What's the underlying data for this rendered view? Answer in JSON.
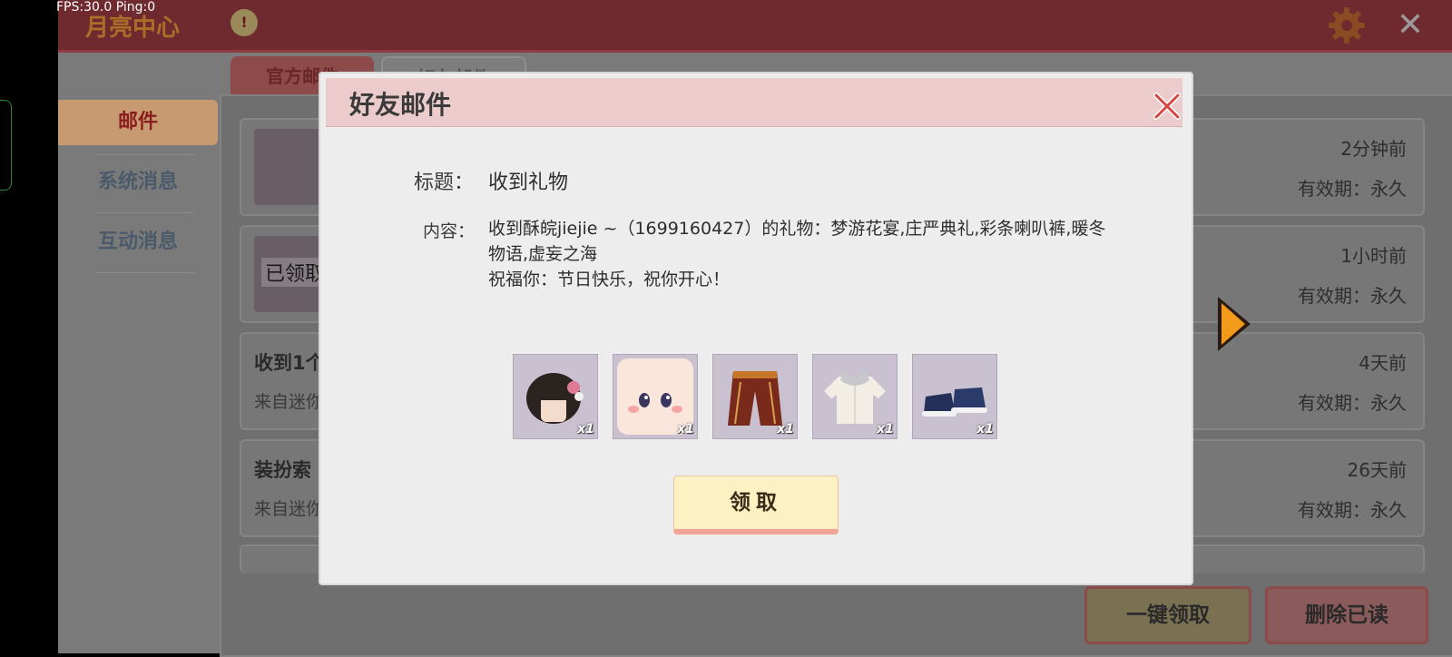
{
  "debug": {
    "fps_text": "FPS:30.0  Ping:0"
  },
  "topbar": {
    "logo_text": "月亮中心",
    "badge_text": "!"
  },
  "sidebar": {
    "items": [
      {
        "label": "邮件"
      },
      {
        "label": "系统消息"
      },
      {
        "label": "互动消息"
      }
    ]
  },
  "tabs": {
    "official": "官方邮件",
    "friend": "好友邮件"
  },
  "mail_list": [
    {
      "title": "",
      "from": "",
      "time": "2分钟前",
      "expiry": "有效期：永久",
      "has_thumb": true
    },
    {
      "title": "",
      "from": "",
      "time": "1小时前",
      "expiry": "有效期：永久",
      "has_thumb": true,
      "claimed_label": "已领取"
    },
    {
      "title": "收到1个",
      "from": "来自迷你",
      "time": "4天前",
      "expiry": "有效期：永久"
    },
    {
      "title": "装扮索",
      "from": "来自迷你",
      "time": "26天前",
      "expiry": "有效期：永久"
    }
  ],
  "bottom_buttons": {
    "claim_all": "一键领取",
    "delete_read": "删除已读"
  },
  "dialog": {
    "title": "好友邮件",
    "subject_label": "标题：",
    "subject": "收到礼物",
    "content_label": "内容：",
    "content_line1": "收到酥皖jiejie ~（1699160427）的礼物：梦游花宴,庄严典礼,彩条喇叭裤,暖冬物语,虚妄之海",
    "content_line2": "祝福你：节日快乐，祝你开心！",
    "items": [
      {
        "name": "hair-item",
        "qty": "x1"
      },
      {
        "name": "face-item",
        "qty": "x1"
      },
      {
        "name": "pants-item",
        "qty": "x1"
      },
      {
        "name": "sweater-item",
        "qty": "x1"
      },
      {
        "name": "shoes-item",
        "qty": "x1"
      }
    ],
    "claim_button": "领取"
  },
  "colors": {
    "accent_red": "#8f3b40",
    "claim_button_bg": "#fbf1c2",
    "arrow_orange": "#f39a1a"
  }
}
